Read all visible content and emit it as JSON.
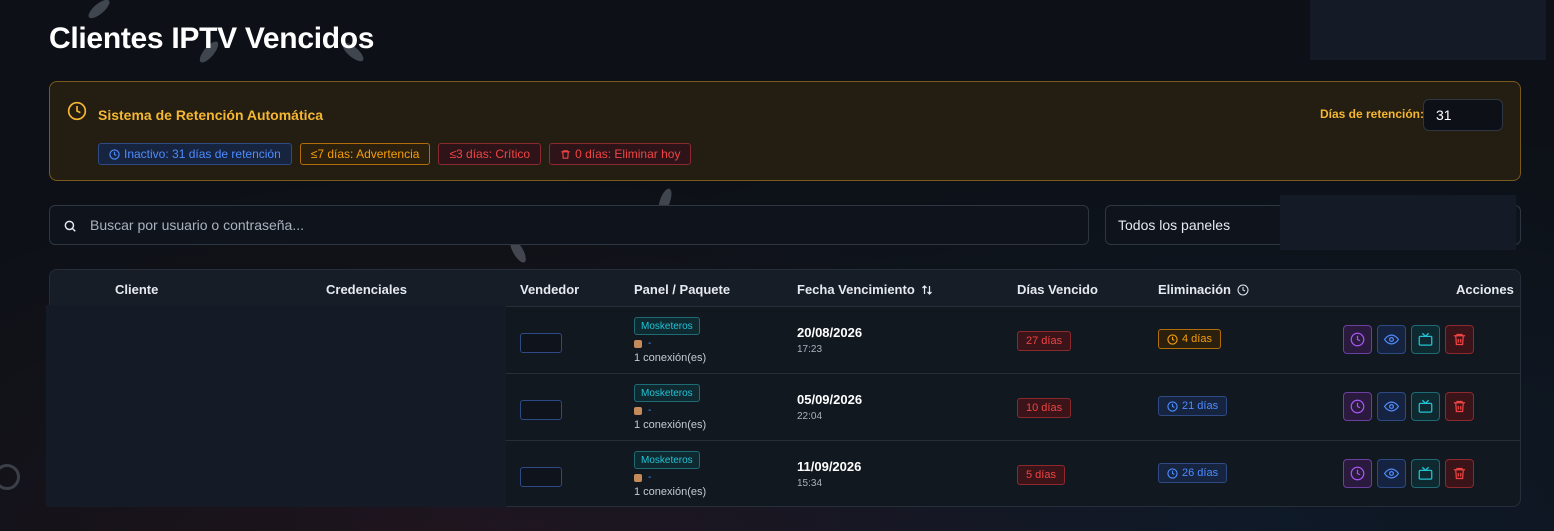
{
  "page": {
    "title": "Clientes IPTV Vencidos"
  },
  "retention": {
    "title": "Sistema de Retención Automática",
    "days_label": "Días de retención:",
    "days_value": "31",
    "badges": [
      {
        "text": "Inactivo: 31 días de retención",
        "color": "blue"
      },
      {
        "text": "≤7 días: Advertencia",
        "color": "orange"
      },
      {
        "text": "≤3 días: Crítico",
        "color": "red"
      },
      {
        "text": "0 días: Eliminar hoy",
        "color": "red"
      }
    ]
  },
  "search": {
    "placeholder": "Buscar por usuario o contraseña..."
  },
  "panel_filter": {
    "selected": "Todos los paneles"
  },
  "table": {
    "headers": {
      "cliente": "Cliente",
      "credenciales": "Credenciales",
      "vendedor": "Vendedor",
      "panel": "Panel / Paquete",
      "fecha": "Fecha Vencimiento",
      "dias": "Días Vencido",
      "eliminacion": "Eliminación",
      "acciones": "Acciones"
    },
    "rows": [
      {
        "panel": "Mosketeros",
        "paquete": "-",
        "conexiones": "1 conexión(es)",
        "fecha": "20/08/2026",
        "hora": "17:23",
        "dias_vencido": "27 días",
        "eliminacion": "4 días",
        "elim_color": "orange"
      },
      {
        "panel": "Mosketeros",
        "paquete": "-",
        "conexiones": "1 conexión(es)",
        "fecha": "05/09/2026",
        "hora": "22:04",
        "dias_vencido": "10 días",
        "eliminacion": "21 días",
        "elim_color": "blue"
      },
      {
        "panel": "Mosketeros",
        "paquete": "-",
        "conexiones": "1 conexión(es)",
        "fecha": "11/09/2026",
        "hora": "15:34",
        "dias_vencido": "5 días",
        "eliminacion": "26 días",
        "elim_color": "blue"
      }
    ],
    "action_icons": [
      "clock-icon",
      "eye-icon",
      "tv-icon",
      "trash-icon"
    ]
  },
  "colors": {
    "accent_warning": "#f5b731",
    "blue": "#4d8cff",
    "red": "#ef4444",
    "teal": "#22c3d6",
    "purple": "#a855f7"
  }
}
